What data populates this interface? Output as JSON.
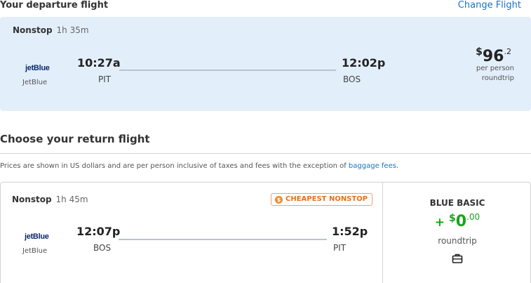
{
  "departure": {
    "heading": "Your departure flight",
    "change_link": "Change Flight",
    "stops": "Nonstop",
    "duration": "1h 35m",
    "airline_logo": "jetBlue",
    "airline_name": "JetBlue",
    "depart_time": "10:27a",
    "depart_code": "PIT",
    "arrive_time": "12:02p",
    "arrive_code": "BOS",
    "price_currency": "$",
    "price_amount": "96",
    "price_cents": ".2",
    "price_note_1": "per person",
    "price_note_2": "roundtrip"
  },
  "return_section": {
    "heading": "Choose your return flight",
    "notice_text": "Prices are shown in US dollars and are per person inclusive of taxes and fees with the exception of ",
    "notice_link": "baggage fees",
    "notice_end": "."
  },
  "return_flight": {
    "stops": "Nonstop",
    "duration": "1h 45m",
    "badge_label": "CHEAPEST NONSTOP",
    "badge_icon": "tag-icon",
    "airline_logo": "jetBlue",
    "airline_name": "JetBlue",
    "depart_time": "12:07p",
    "depart_code": "BOS",
    "arrive_time": "1:52p",
    "arrive_code": "PIT",
    "fare_name": "BLUE BASIC",
    "fare_plus": "+",
    "fare_currency": "$",
    "fare_amount": "0",
    "fare_cents": ".00",
    "fare_note": "roundtrip",
    "fare_icon": "briefcase-icon"
  },
  "colors": {
    "link": "#1a73c8",
    "card_bg": "#e3eefb",
    "fare_green": "#1aa31a",
    "badge_orange": "#e8711a"
  }
}
